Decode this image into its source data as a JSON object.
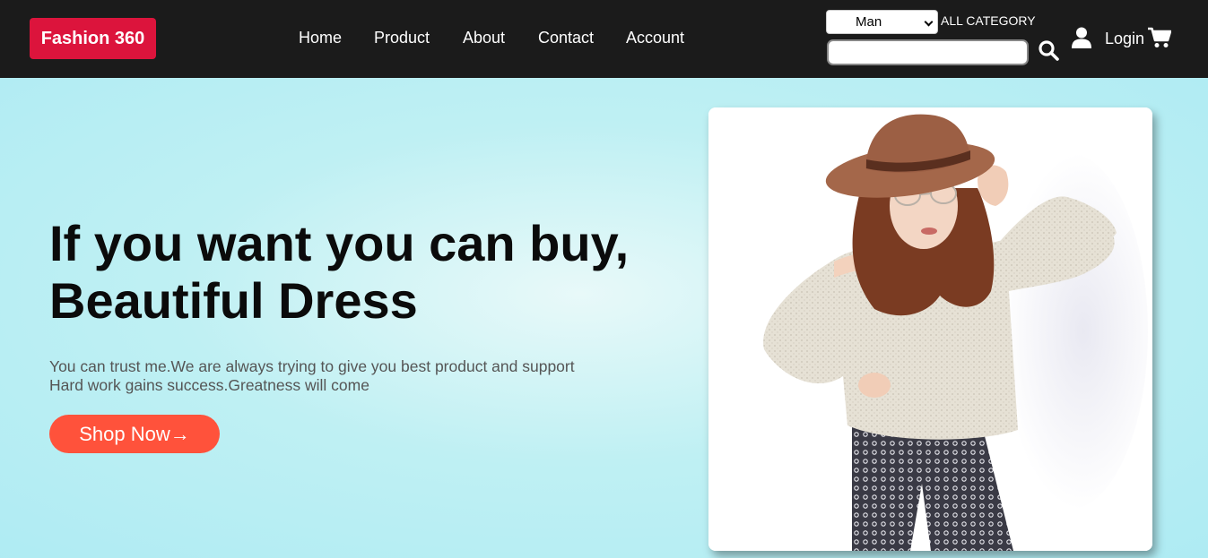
{
  "brand": {
    "logo_text": "Fashion 360",
    "logo_color": "#dc143c"
  },
  "nav": {
    "items": [
      {
        "label": "Home"
      },
      {
        "label": "Product"
      },
      {
        "label": "About"
      },
      {
        "label": "Contact"
      },
      {
        "label": "Account"
      }
    ]
  },
  "header_tools": {
    "category_select": {
      "value": "Man",
      "label": "ALL CATEGORY"
    },
    "search": {
      "value": "",
      "placeholder": ""
    },
    "icons": {
      "search": "search-icon",
      "user": "user-icon",
      "cart": "cart-icon"
    },
    "login_label": "Login"
  },
  "hero": {
    "headline_line1": "If you want you can buy,",
    "headline_line2": "Beautiful Dress",
    "subtext_line1": "You can trust me.We are always trying to give you best product and support",
    "subtext_line2": "Hard work gains success.Greatness will come",
    "cta_label": "Shop Now→",
    "cta_color": "#ff523b",
    "image": "woman-in-hat-and-sweater-photo"
  },
  "colors": {
    "navbar_bg": "#1b1b1b",
    "hero_bg": "#b3eef4"
  }
}
